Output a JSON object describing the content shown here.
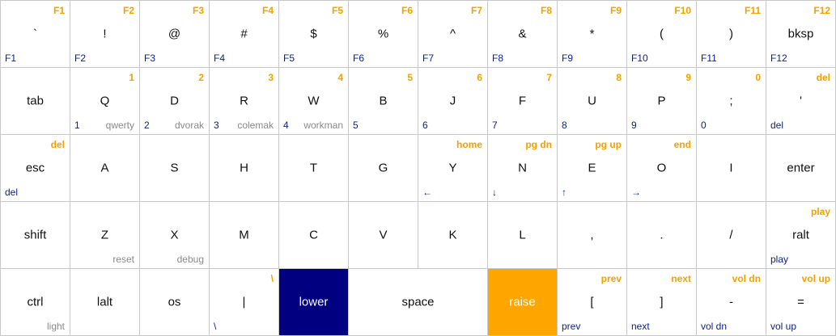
{
  "keyboard": {
    "colors": {
      "raise_legend": "#f5a000",
      "lower_legend": "#0a1f8f",
      "adjust_legend": "#8a8a8a",
      "lower_key_bg": "#000080",
      "raise_key_bg": "#ffa500"
    },
    "rows": [
      [
        {
          "name": "key-backtick",
          "main": "`",
          "raise": "F1",
          "lower": "F1"
        },
        {
          "name": "key-exclamation",
          "main": "!",
          "raise": "F2",
          "lower": "F2"
        },
        {
          "name": "key-at",
          "main": "@",
          "raise": "F3",
          "lower": "F3"
        },
        {
          "name": "key-hash",
          "main": "#",
          "raise": "F4",
          "lower": "F4"
        },
        {
          "name": "key-dollar",
          "main": "$",
          "raise": "F5",
          "lower": "F5"
        },
        {
          "name": "key-percent",
          "main": "%",
          "raise": "F6",
          "lower": "F6"
        },
        {
          "name": "key-caret",
          "main": "^",
          "raise": "F7",
          "lower": "F7"
        },
        {
          "name": "key-ampersand",
          "main": "&",
          "raise": "F8",
          "lower": "F8"
        },
        {
          "name": "key-asterisk",
          "main": "*",
          "raise": "F9",
          "lower": "F9"
        },
        {
          "name": "key-lparen",
          "main": "(",
          "raise": "F10",
          "lower": "F10"
        },
        {
          "name": "key-rparen",
          "main": ")",
          "raise": "F11",
          "lower": "F11"
        },
        {
          "name": "key-bksp",
          "main": "bksp",
          "raise": "F12",
          "lower": "F12"
        }
      ],
      [
        {
          "name": "key-tab",
          "main": "tab"
        },
        {
          "name": "key-q",
          "main": "Q",
          "raise": "1",
          "lower": "1",
          "adjust": "qwerty"
        },
        {
          "name": "key-d",
          "main": "D",
          "raise": "2",
          "lower": "2",
          "adjust": "dvorak"
        },
        {
          "name": "key-r",
          "main": "R",
          "raise": "3",
          "lower": "3",
          "adjust": "colemak"
        },
        {
          "name": "key-w",
          "main": "W",
          "raise": "4",
          "lower": "4",
          "adjust": "workman"
        },
        {
          "name": "key-b",
          "main": "B",
          "raise": "5",
          "lower": "5"
        },
        {
          "name": "key-j",
          "main": "J",
          "raise": "6",
          "lower": "6"
        },
        {
          "name": "key-f",
          "main": "F",
          "raise": "7",
          "lower": "7"
        },
        {
          "name": "key-u",
          "main": "U",
          "raise": "8",
          "lower": "8"
        },
        {
          "name": "key-p",
          "main": "P",
          "raise": "9",
          "lower": "9"
        },
        {
          "name": "key-semicolon",
          "main": ";",
          "raise": "0",
          "lower": "0"
        },
        {
          "name": "key-quote",
          "main": "'",
          "raise": "del",
          "lower": "del"
        }
      ],
      [
        {
          "name": "key-esc",
          "main": "esc",
          "raise": "del",
          "lower": "del"
        },
        {
          "name": "key-a",
          "main": "A"
        },
        {
          "name": "key-s",
          "main": "S"
        },
        {
          "name": "key-h",
          "main": "H"
        },
        {
          "name": "key-t",
          "main": "T"
        },
        {
          "name": "key-g",
          "main": "G"
        },
        {
          "name": "key-y",
          "main": "Y",
          "raise": "home",
          "lower": "←"
        },
        {
          "name": "key-n",
          "main": "N",
          "raise": "pg dn",
          "lower": "↓"
        },
        {
          "name": "key-e",
          "main": "E",
          "raise": "pg up",
          "lower": "↑"
        },
        {
          "name": "key-o",
          "main": "O",
          "raise": "end",
          "lower": "→"
        },
        {
          "name": "key-i",
          "main": "I"
        },
        {
          "name": "key-enter",
          "main": "enter"
        }
      ],
      [
        {
          "name": "key-shift",
          "main": "shift"
        },
        {
          "name": "key-z",
          "main": "Z",
          "adjust": "reset"
        },
        {
          "name": "key-x",
          "main": "X",
          "adjust": "debug"
        },
        {
          "name": "key-m",
          "main": "M"
        },
        {
          "name": "key-c",
          "main": "C"
        },
        {
          "name": "key-v",
          "main": "V"
        },
        {
          "name": "key-k",
          "main": "K"
        },
        {
          "name": "key-l",
          "main": "L"
        },
        {
          "name": "key-comma",
          "main": ","
        },
        {
          "name": "key-period",
          "main": "."
        },
        {
          "name": "key-slash",
          "main": "/"
        },
        {
          "name": "key-ralt",
          "main": "ralt",
          "raise": "play",
          "lower": "play"
        }
      ],
      [
        {
          "name": "key-ctrl",
          "main": "ctrl",
          "adjust": "light"
        },
        {
          "name": "key-lalt",
          "main": "lalt"
        },
        {
          "name": "key-os",
          "main": "os"
        },
        {
          "name": "key-pipe",
          "main": "|",
          "raise": "\\",
          "lower": "\\"
        },
        {
          "name": "key-lower",
          "main": "lower",
          "style": "lower-key"
        },
        {
          "name": "key-space",
          "main": "space",
          "span": 2
        },
        {
          "name": "key-raise",
          "main": "raise",
          "style": "raise-key"
        },
        {
          "name": "key-lbracket",
          "main": "[",
          "raise": "prev",
          "lower": "prev"
        },
        {
          "name": "key-rbracket",
          "main": "]",
          "raise": "next",
          "lower": "next"
        },
        {
          "name": "key-minus",
          "main": "-",
          "raise": "vol dn",
          "lower": "vol dn"
        },
        {
          "name": "key-equals",
          "main": "=",
          "raise": "vol up",
          "lower": "vol up"
        }
      ]
    ]
  }
}
